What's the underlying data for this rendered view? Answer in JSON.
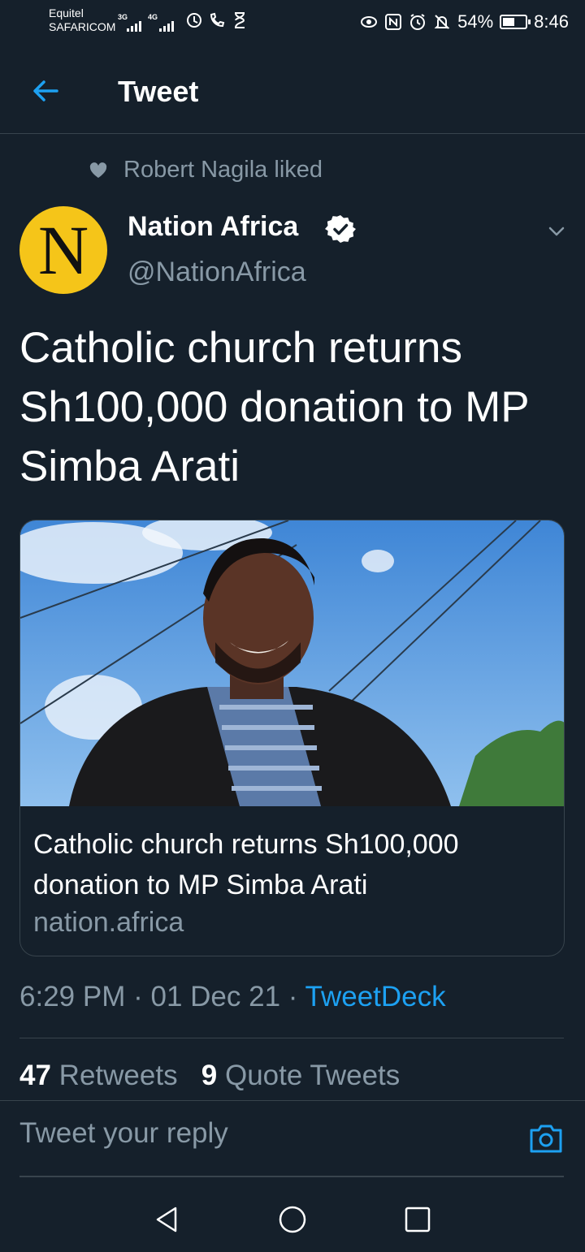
{
  "status_bar": {
    "carrier_1": "Equitel",
    "carrier_2": "SAFARICOM",
    "signal_1_tag": "3G",
    "signal_2_tag": "4G",
    "battery_percent": "54%",
    "battery_level": 0.54,
    "time": "8:46"
  },
  "header": {
    "title": "Tweet"
  },
  "tweet": {
    "social_context": "Robert Nagila liked",
    "avatar_letter": "N",
    "display_name": "Nation Africa",
    "handle": "@NationAfrica",
    "text": "Catholic church returns Sh100,000 donation to MP Simba Arati",
    "card": {
      "title": "Catholic church returns Sh100,000 donation to MP Simba Arati",
      "domain": "nation.africa"
    },
    "time": "6:29 PM",
    "separator": "·",
    "date": "01 Dec 21",
    "source": "TweetDeck",
    "retweets_count": "47",
    "retweets_label": "Retweets",
    "quotes_count": "9",
    "quotes_label": "Quote Tweets"
  },
  "reply": {
    "placeholder": "Tweet your reply"
  },
  "colors": {
    "background": "#15202b",
    "accent": "#1da1f2",
    "muted": "#8899a6",
    "border": "#38444d",
    "avatar": "#f5c519"
  }
}
